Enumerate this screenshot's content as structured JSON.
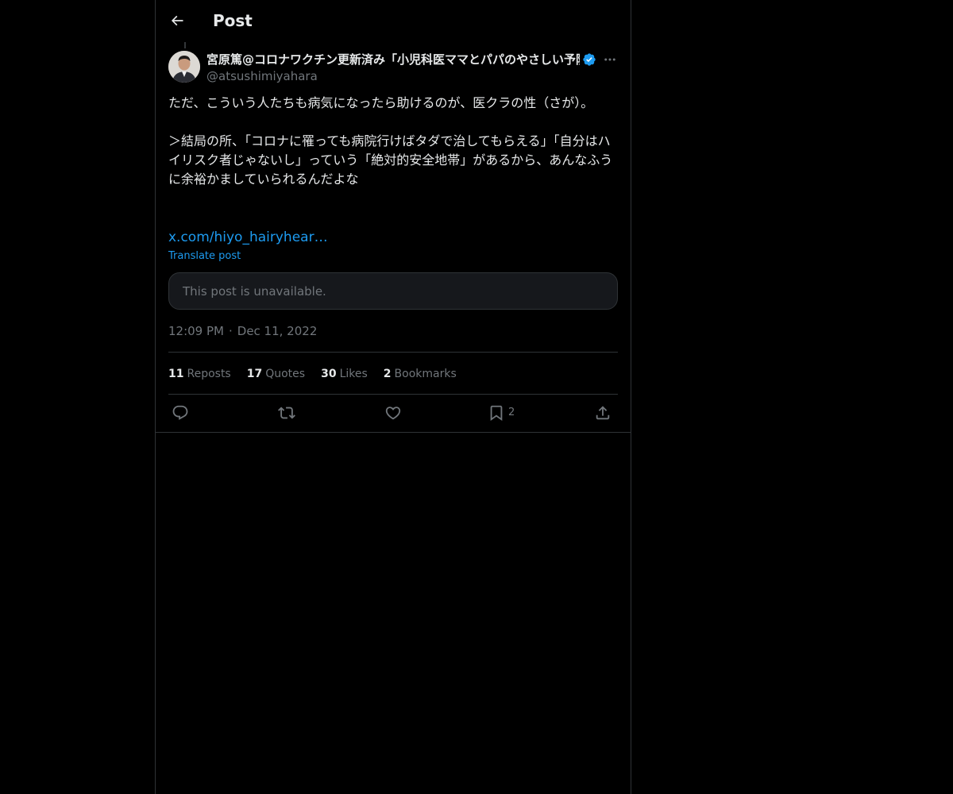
{
  "header": {
    "title": "Post",
    "back_icon": "arrow-left-icon"
  },
  "author": {
    "name": "宮原篤@コロナワクチン更新済み「小児科医ママとパパのやさしい予防",
    "handle": "@atsushimiyahara",
    "verified": true,
    "verified_icon": "verified-badge-icon",
    "more_icon": "more-horizontal-icon"
  },
  "post": {
    "paragraph_1": "ただ、こういう人たちも病気になったら助けるのが、医クラの性（さが）。",
    "paragraph_2": "＞結局の所、「コロナに罹っても病院行けばタダで治してもらえる」「自分はハイリスク者じゃないし」っていう「絶対的安全地帯」があるから、あんなふうに余裕かましていられるんだよな",
    "link": "x.com/hiyo_hairyhear…",
    "translate_label": "Translate post"
  },
  "quoted_post": {
    "text": "This post is unavailable."
  },
  "meta": {
    "time": "12:09 PM",
    "separator": "·",
    "date": "Dec 11, 2022"
  },
  "stats": {
    "reposts_count": "11",
    "reposts_label": "Reposts",
    "quotes_count": "17",
    "quotes_label": "Quotes",
    "likes_count": "30",
    "likes_label": "Likes",
    "bookmarks_count": "2",
    "bookmarks_label": "Bookmarks"
  },
  "actions": {
    "reply_icon": "reply-icon",
    "repost_icon": "repost-icon",
    "like_icon": "heart-icon",
    "bookmark_icon": "bookmark-icon",
    "bookmark_count": "2",
    "share_icon": "share-icon"
  },
  "colors": {
    "background": "#000000",
    "text": "#e7e9ea",
    "muted": "#71767b",
    "accent": "#1d9bf0",
    "border": "#2f3336"
  }
}
